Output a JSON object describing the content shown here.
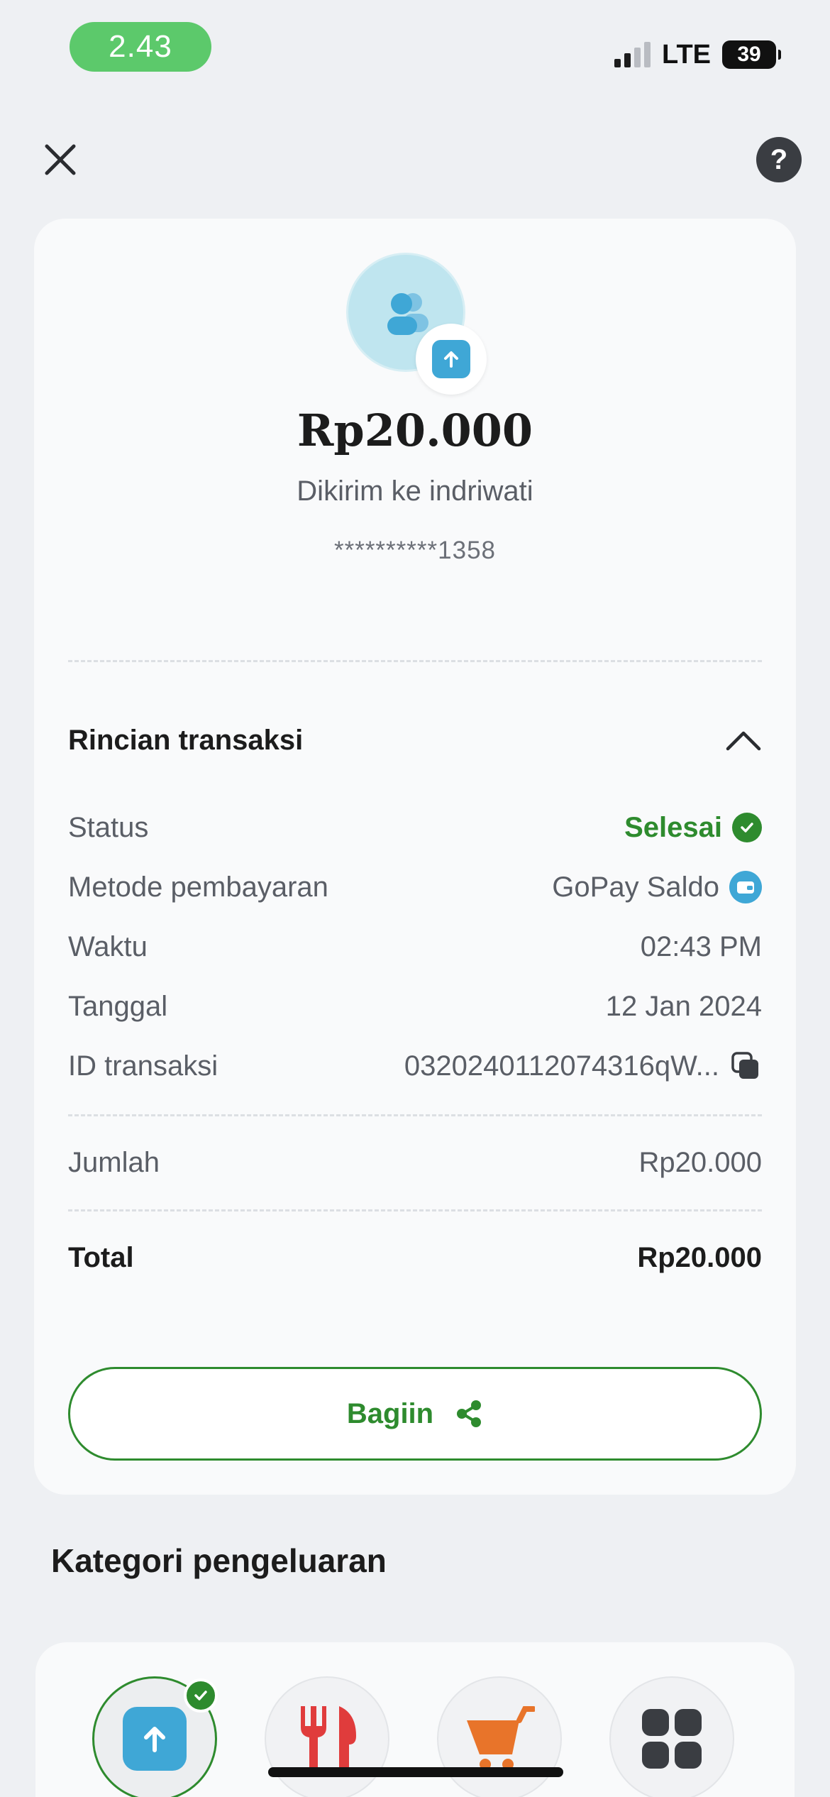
{
  "status_bar": {
    "time": "2.43",
    "network": "LTE",
    "battery": "39"
  },
  "header": {
    "help_symbol": "?"
  },
  "transfer": {
    "amount": "Rp20.000",
    "recipient": "Dikirim ke indriwati",
    "account_masked": "**********1358"
  },
  "details": {
    "title": "Rincian transaksi",
    "rows": {
      "status": {
        "label": "Status",
        "value": "Selesai"
      },
      "method": {
        "label": "Metode pembayaran",
        "value": "GoPay Saldo"
      },
      "time": {
        "label": "Waktu",
        "value": "02:43 PM"
      },
      "date": {
        "label": "Tanggal",
        "value": "12 Jan 2024"
      },
      "id": {
        "label": "ID transaksi",
        "value": "0320240112074316qW..."
      }
    },
    "amount": {
      "label": "Jumlah",
      "value": "Rp20.000"
    },
    "total": {
      "label": "Total",
      "value": "Rp20.000"
    }
  },
  "share": {
    "label": "Bagiin"
  },
  "categories": {
    "title": "Kategori pengeluaran",
    "items": [
      {
        "icon": "transfer-icon",
        "selected": true
      },
      {
        "icon": "food-icon",
        "selected": false
      },
      {
        "icon": "shopping-cart-icon",
        "selected": false
      },
      {
        "icon": "grid-icon",
        "selected": false
      }
    ]
  },
  "colors": {
    "accent": "#2e8b2e",
    "blue": "#3fa7d6",
    "time_pill": "#5cc96b"
  }
}
